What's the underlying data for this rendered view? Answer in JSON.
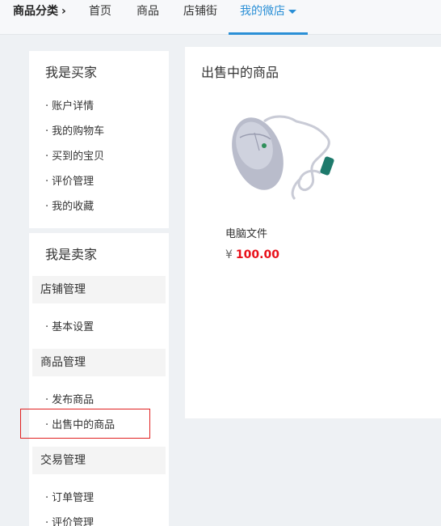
{
  "topnav": {
    "category": "商品分类",
    "items": [
      "首页",
      "商品",
      "店铺街",
      "我的微店"
    ]
  },
  "buyer": {
    "title": "我是买家",
    "links": [
      "账户详情",
      "我的购物车",
      "买到的宝贝",
      "评价管理",
      "我的收藏"
    ]
  },
  "seller": {
    "title": "我是卖家",
    "groups": [
      {
        "head": "店铺管理",
        "links": [
          "基本设置"
        ]
      },
      {
        "head": "商品管理",
        "links": [
          "发布商品",
          "出售中的商品"
        ]
      },
      {
        "head": "交易管理",
        "links": [
          "订单管理",
          "评价管理"
        ]
      }
    ]
  },
  "main": {
    "title": "出售中的商品",
    "product": {
      "name": "电脑文件",
      "currency": "¥",
      "price": "100.00"
    }
  },
  "colors": {
    "accent": "#2a8fd6",
    "price": "#e8101a",
    "highlight": "#e02020"
  }
}
